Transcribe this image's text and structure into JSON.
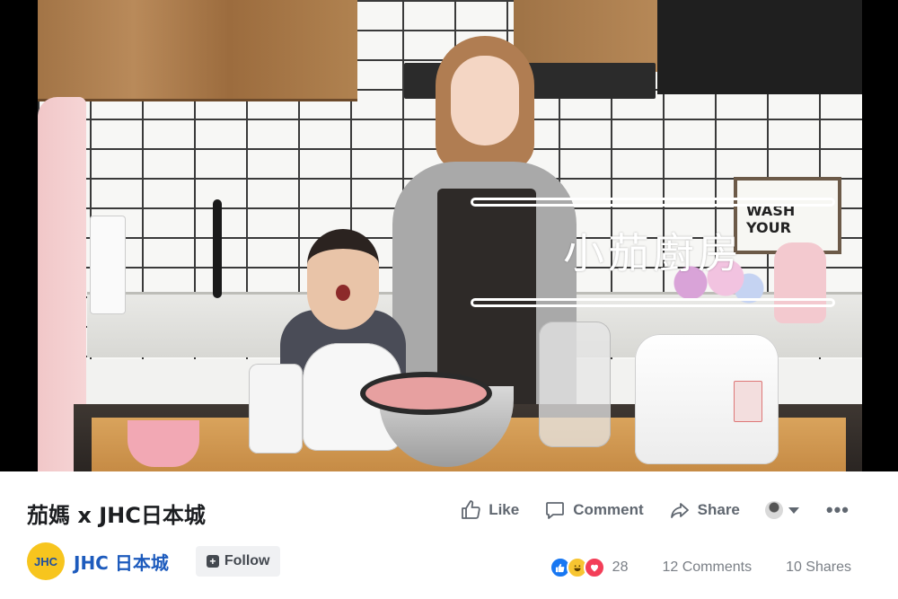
{
  "video": {
    "overlay_title": "小茄廚房",
    "sign_text": "WASH YOUR"
  },
  "post": {
    "title": "茄媽 x JHC日本城"
  },
  "actions": {
    "like_label": "Like",
    "comment_label": "Comment",
    "share_label": "Share"
  },
  "page": {
    "avatar_text": "JHC",
    "name": "JHC 日本城",
    "follow_label": "Follow"
  },
  "stats": {
    "reaction_count": "28",
    "comments": "12 Comments",
    "shares": "10 Shares"
  },
  "colors": {
    "link_blue": "#1d5bbd",
    "like_blue": "#1877f2",
    "love_red": "#f33e58",
    "haha_yellow": "#f7c531",
    "page_avatar_yellow": "#f7c51e"
  }
}
